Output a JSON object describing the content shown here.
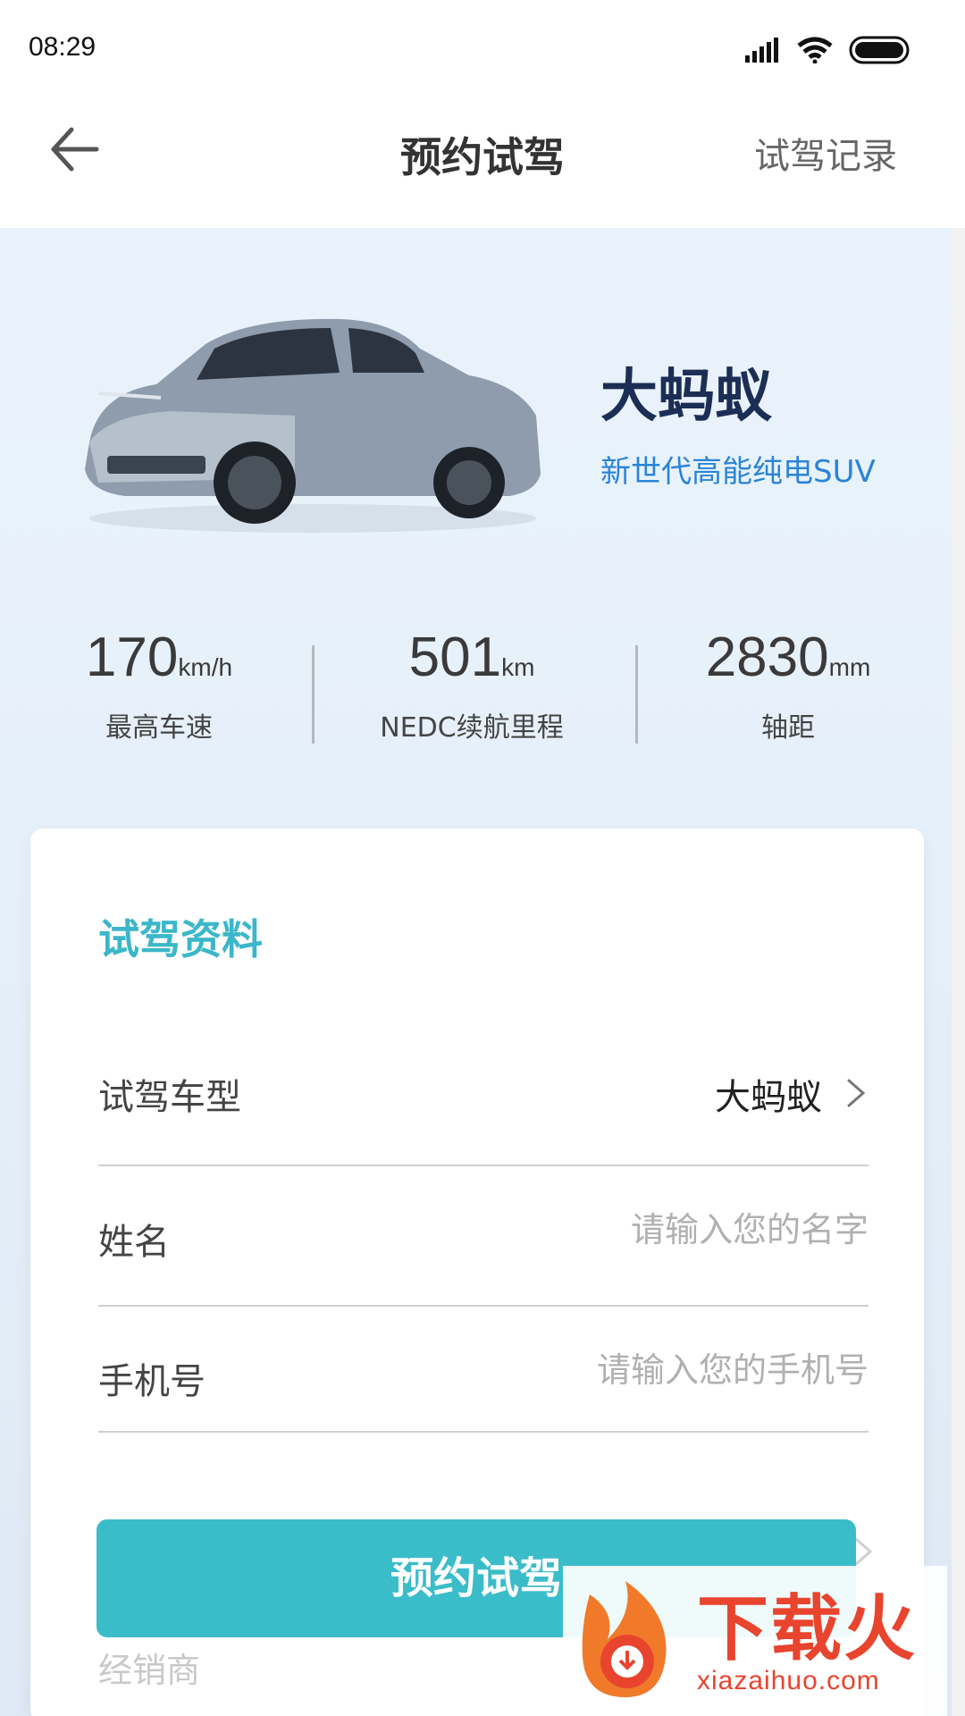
{
  "status_bar": {
    "time": "08:29",
    "icons": [
      "signal-icon",
      "wifi-icon",
      "battery-icon"
    ]
  },
  "nav": {
    "back_icon": "arrow-left-icon",
    "title": "预约试驾",
    "action": "试驾记录"
  },
  "vehicle": {
    "name": "大蚂蚁",
    "slogan": "新世代高能纯电SUV",
    "image_icon": "car-image"
  },
  "specs": [
    {
      "value": "170",
      "unit": "km/h",
      "label": "最高车速"
    },
    {
      "value": "501",
      "unit": "km",
      "label": "NEDC续航里程"
    },
    {
      "value": "2830",
      "unit": "mm",
      "label": "轴距"
    }
  ],
  "form": {
    "title": "试驾资料",
    "model": {
      "label": "试驾车型",
      "value": "大蚂蚁"
    },
    "name": {
      "label": "姓名",
      "placeholder": "请输入您的名字"
    },
    "phone": {
      "label": "手机号",
      "placeholder": "请输入您的手机号"
    },
    "dealer": {
      "label": "经销商"
    }
  },
  "submit_label": "预约试驾",
  "watermark": {
    "text": "下载火",
    "url": "xiazaihuo.com"
  },
  "colors": {
    "accent": "#3bbcc9",
    "title_accent": "#3bb7c9",
    "slogan": "#2a84d6",
    "car_name": "#1c2e55",
    "watermark": "#e8442e"
  }
}
